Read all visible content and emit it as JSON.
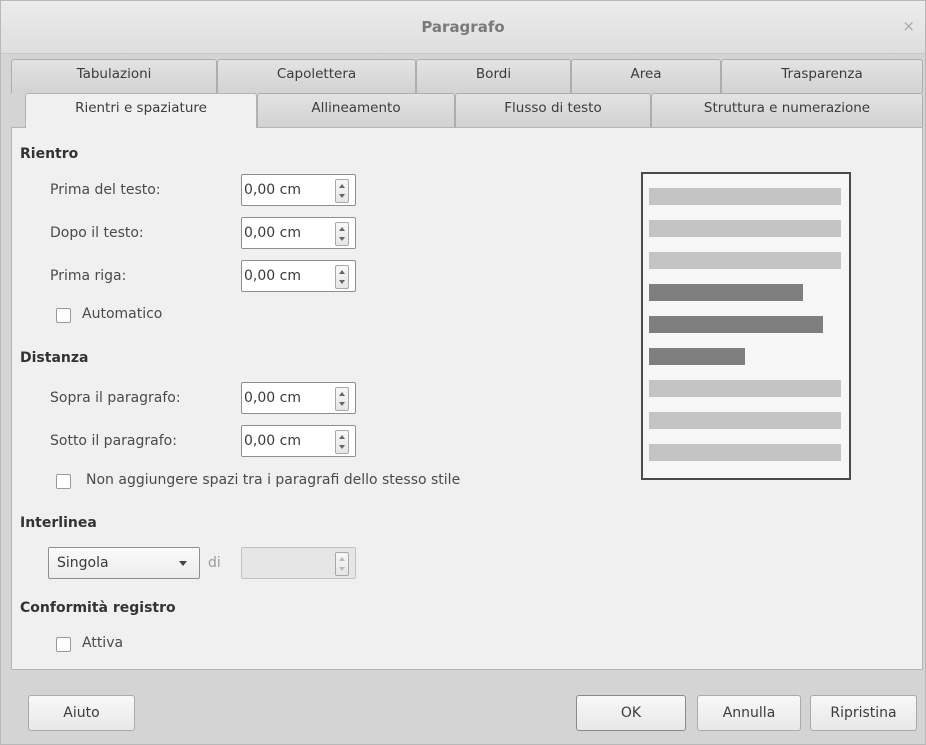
{
  "window": {
    "title": "Paragrafo",
    "close_glyph": "×"
  },
  "tabs_row1": [
    {
      "label": "Tabulazioni"
    },
    {
      "label": "Capolettera"
    },
    {
      "label": "Bordi"
    },
    {
      "label": "Area"
    },
    {
      "label": "Trasparenza"
    }
  ],
  "tabs_row2": [
    {
      "label": "Rientri e spaziature",
      "active": true
    },
    {
      "label": "Allineamento"
    },
    {
      "label": "Flusso di testo"
    },
    {
      "label": "Struttura e numerazione"
    }
  ],
  "rientro": {
    "heading": "Rientro",
    "before_text": {
      "label": "Prima del testo:",
      "value": "0,00 cm"
    },
    "after_text": {
      "label": "Dopo il testo:",
      "value": "0,00 cm"
    },
    "first_line": {
      "label": "Prima riga:",
      "value": "0,00 cm"
    },
    "automatic": {
      "label": "Automatico",
      "checked": false
    }
  },
  "distanza": {
    "heading": "Distanza",
    "above": {
      "label": "Sopra il paragrafo:",
      "value": "0,00 cm"
    },
    "below": {
      "label": "Sotto il paragrafo:",
      "value": "0,00 cm"
    },
    "no_space": {
      "label": "Non aggiungere spazi tra i paragrafi dello stesso stile",
      "checked": false
    }
  },
  "interlinea": {
    "heading": "Interlinea",
    "selected": "Singola",
    "di_label": "di",
    "value": ""
  },
  "conformita": {
    "heading": "Conformità registro",
    "active": {
      "label": "Attiva",
      "checked": false
    }
  },
  "buttons": {
    "help": "Aiuto",
    "ok": "OK",
    "cancel": "Annulla",
    "reset": "Ripristina"
  },
  "colors": {
    "preview_light": "#c4c4c4",
    "preview_dark": "#7e7e7e",
    "panel_bg": "#f0f0f0"
  },
  "icons": [
    "close-icon",
    "spin-up-icon",
    "spin-down-icon",
    "dropdown-caret-icon"
  ]
}
